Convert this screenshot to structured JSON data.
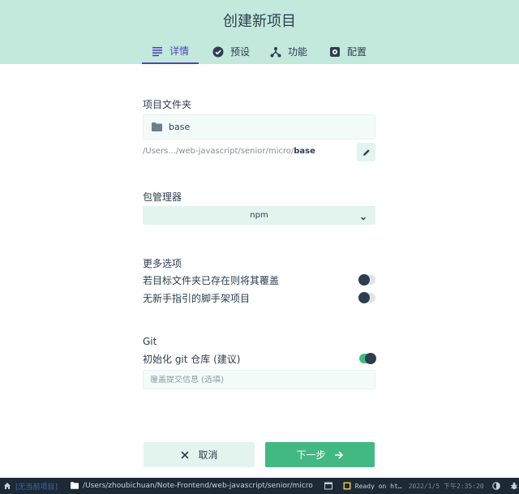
{
  "header": {
    "title": "创建新项目"
  },
  "tabs": [
    {
      "label": "详情",
      "icon": "list-icon",
      "active": true
    },
    {
      "label": "预设",
      "icon": "check-circle-icon",
      "active": false
    },
    {
      "label": "功能",
      "icon": "fork-icon",
      "active": false
    },
    {
      "label": "配置",
      "icon": "gear-icon",
      "active": false
    }
  ],
  "folder": {
    "label": "项目文件夹",
    "name": "base",
    "path_prefix": "/Users.../web-javascript/senior/micro/",
    "path_name": "base"
  },
  "package_manager": {
    "label": "包管理器",
    "value": "npm"
  },
  "more_options": {
    "label": "更多选项",
    "items": [
      {
        "label": "若目标文件夹已存在则将其覆盖",
        "on": false
      },
      {
        "label": "无新手指引的脚手架项目",
        "on": false
      }
    ]
  },
  "git": {
    "label": "Git",
    "init_label": "初始化 git 仓库 (建议)",
    "init_on": true,
    "commit_placeholder": "覆盖提交信息 (选填)"
  },
  "actions": {
    "cancel": "取消",
    "next": "下一步"
  },
  "statusbar": {
    "project": "[无当前项目]",
    "path": "/Users/zhoubichuan/Note-Frontend/web-javascript/senior/micro",
    "log": "Ready on ht…",
    "time": "2022/1/5 下午2:35:20"
  },
  "colors": {
    "accent": "#42b983",
    "header_bg": "#c3e9dc",
    "tab_active": "#4f46b8",
    "statusbar_bg": "#1d2935"
  }
}
